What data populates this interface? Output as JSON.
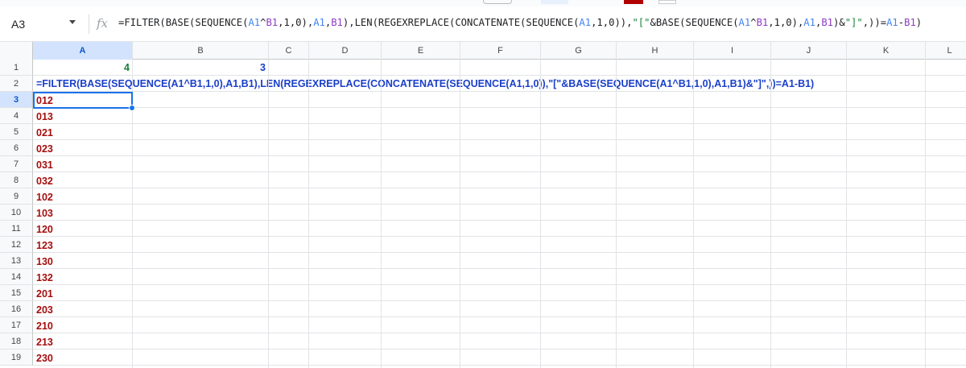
{
  "name_box": {
    "value": "A3"
  },
  "formula_bar": {
    "parts": [
      {
        "t": "=FILTER(BASE(SEQUENCE(",
        "c": ""
      },
      {
        "t": "A1",
        "c": "ref-a"
      },
      {
        "t": "^",
        "c": ""
      },
      {
        "t": "B1",
        "c": "ref-b"
      },
      {
        "t": ",1,0),",
        "c": ""
      },
      {
        "t": "A1",
        "c": "ref-a"
      },
      {
        "t": ",",
        "c": ""
      },
      {
        "t": "B1",
        "c": "ref-b"
      },
      {
        "t": "),LEN(REGEXREPLACE(CONCATENATE(SEQUENCE(",
        "c": ""
      },
      {
        "t": "A1",
        "c": "ref-a"
      },
      {
        "t": ",1,0)),",
        "c": ""
      },
      {
        "t": "\"[\"",
        "c": "str"
      },
      {
        "t": "&BASE(SEQUENCE(",
        "c": ""
      },
      {
        "t": "A1",
        "c": "ref-a"
      },
      {
        "t": "^",
        "c": ""
      },
      {
        "t": "B1",
        "c": "ref-b"
      },
      {
        "t": ",1,0),",
        "c": ""
      },
      {
        "t": "A1",
        "c": "ref-a"
      },
      {
        "t": ",",
        "c": ""
      },
      {
        "t": "B1",
        "c": "ref-b"
      },
      {
        "t": ")&",
        "c": ""
      },
      {
        "t": "\"]\"",
        "c": "str"
      },
      {
        "t": ",))=",
        "c": ""
      },
      {
        "t": "A1",
        "c": "ref-a"
      },
      {
        "t": "-",
        "c": ""
      },
      {
        "t": "B1",
        "c": "ref-b"
      },
      {
        "t": ")",
        "c": ""
      }
    ]
  },
  "columns": [
    "A",
    "B",
    "C",
    "D",
    "E",
    "F",
    "G",
    "H",
    "I",
    "J",
    "K",
    "L"
  ],
  "rows": [
    "1",
    "2",
    "3",
    "4",
    "5",
    "6",
    "7",
    "8",
    "9",
    "10",
    "11",
    "12",
    "13",
    "14",
    "15",
    "16",
    "17",
    "18",
    "19"
  ],
  "cells": {
    "A1": "4",
    "B1": "3",
    "A2": "=FILTER(BASE(SEQUENCE(A1^B1,1,0),A1,B1),LEN(REGEXREPLACE(CONCATENATE(SEQUENCE(A1,1,0)),\"[\"&BASE(SEQUENCE(A1^B1,1,0),A1,B1)&\"]\",))=A1-B1)"
  },
  "results": [
    "012",
    "013",
    "021",
    "023",
    "031",
    "032",
    "102",
    "103",
    "120",
    "123",
    "130",
    "132",
    "201",
    "203",
    "210",
    "213",
    "230"
  ],
  "colors": {
    "selection": "#1a73e8",
    "active_header": "#d3e3fd",
    "result_text": "#a50e0e",
    "formula_text": "#1a3fc9",
    "number_green": "#188038"
  }
}
